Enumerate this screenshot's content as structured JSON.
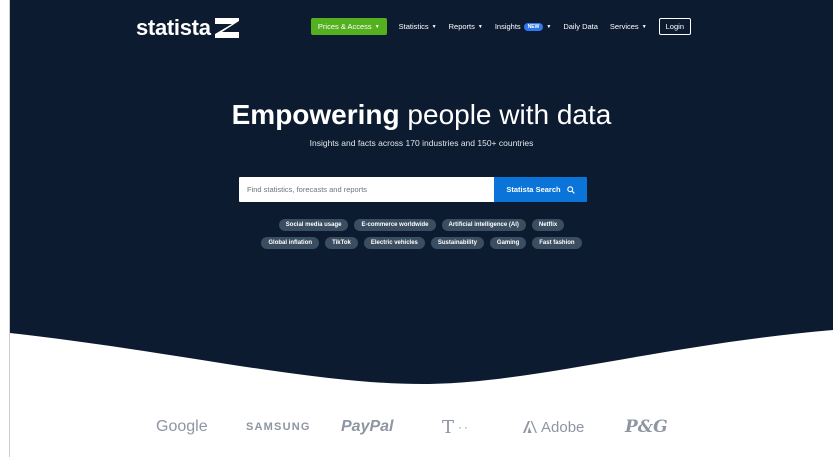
{
  "header": {
    "logo_text": "statista",
    "nav": {
      "prices_access": "Prices & Access",
      "statistics": "Statistics",
      "reports": "Reports",
      "insights": "Insights",
      "insights_badge": "NEW",
      "daily_data": "Daily Data",
      "services": "Services",
      "login": "Login"
    }
  },
  "hero": {
    "headline_bold": "Empowering",
    "headline_rest": " people with data",
    "subline": "Insights and facts across 170 industries and 150+ countries"
  },
  "search": {
    "placeholder": "Find statistics, forecasts and reports",
    "button_label": "Statista Search"
  },
  "chips_row1": [
    "Social media usage",
    "E-commerce worldwide",
    "Artificial intelligence (AI)",
    "Netflix"
  ],
  "chips_row2": [
    "Global inflation",
    "TikTok",
    "Electric vehicles",
    "Sustainability",
    "Gaming",
    "Fast fashion"
  ],
  "partners": {
    "google": "Google",
    "samsung": "SAMSUNG",
    "paypal": "PayPal",
    "adobe": "Adobe",
    "pg": "P&G"
  },
  "colors": {
    "hero_bg": "#0d1b31",
    "primary_green": "#54b01f",
    "search_blue": "#0a74d9",
    "chip_bg": "#3b4d60",
    "partner_grey": "#8d96a1"
  }
}
